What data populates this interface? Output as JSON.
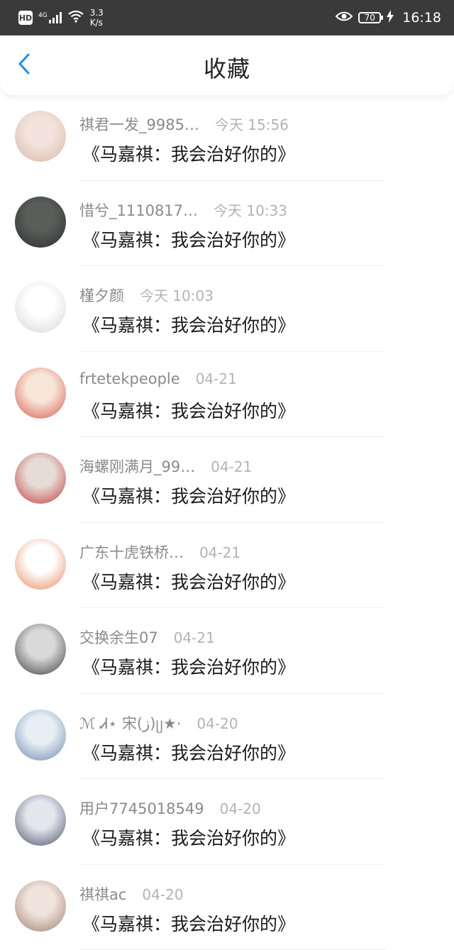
{
  "status_bar": {
    "hd": "HD",
    "network": "4G",
    "speed_value": "3.3",
    "speed_unit": "K/s",
    "battery": "70",
    "time": "16:18"
  },
  "header": {
    "title": "收藏",
    "back_icon": "chevron-left-icon",
    "accent_color": "#1e8ef2"
  },
  "items": [
    {
      "username": "祺君一发_9985…",
      "time": "今天 15:56",
      "content": "《马嘉祺：我会治好你的》",
      "avatar_colors": [
        "#f3e3dc",
        "#d8b8a8"
      ]
    },
    {
      "username": "惜兮_1110817…",
      "time": "今天 10:33",
      "content": "《马嘉祺：我会治好你的》",
      "avatar_colors": [
        "#5a5e5a",
        "#2c2f2c"
      ]
    },
    {
      "username": "槿夕颜",
      "time": "今天 10:03",
      "content": "《马嘉祺：我会治好你的》",
      "avatar_colors": [
        "#ffffff",
        "#d6d6d6"
      ]
    },
    {
      "username": "frtetekpeople",
      "time": "04-21",
      "content": "《马嘉祺：我会治好你的》",
      "avatar_colors": [
        "#f7e6d8",
        "#d9584c"
      ]
    },
    {
      "username": "海螺刚满月_99…",
      "time": "04-21",
      "content": "《马嘉祺：我会治好你的》",
      "avatar_colors": [
        "#e6dcd6",
        "#c53b3b"
      ]
    },
    {
      "username": "广东十虎铁桥…",
      "time": "04-21",
      "content": "《马嘉祺：我会治好你的》",
      "avatar_colors": [
        "#ffffff",
        "#e88a5a"
      ]
    },
    {
      "username": "交换余生07",
      "time": "04-21",
      "content": "《马嘉祺：我会治好你的》",
      "avatar_colors": [
        "#d9d9d9",
        "#3d3d3d"
      ]
    },
    {
      "username": "ℳ Ꮧ⋆ 宋(ز)ᥩ★·",
      "time": "04-20",
      "content": "《马嘉祺：我会治好你的》",
      "avatar_colors": [
        "#e8eef4",
        "#6a8bb0"
      ]
    },
    {
      "username": "用户7745018549",
      "time": "04-20",
      "content": "《马嘉祺：我会治好你的》",
      "avatar_colors": [
        "#e4e6ee",
        "#4a5168"
      ]
    },
    {
      "username": "祺祺ac",
      "time": "04-20",
      "content": "《马嘉祺：我会治好你的》",
      "avatar_colors": [
        "#f1e4dc",
        "#9e7e6e"
      ]
    }
  ]
}
